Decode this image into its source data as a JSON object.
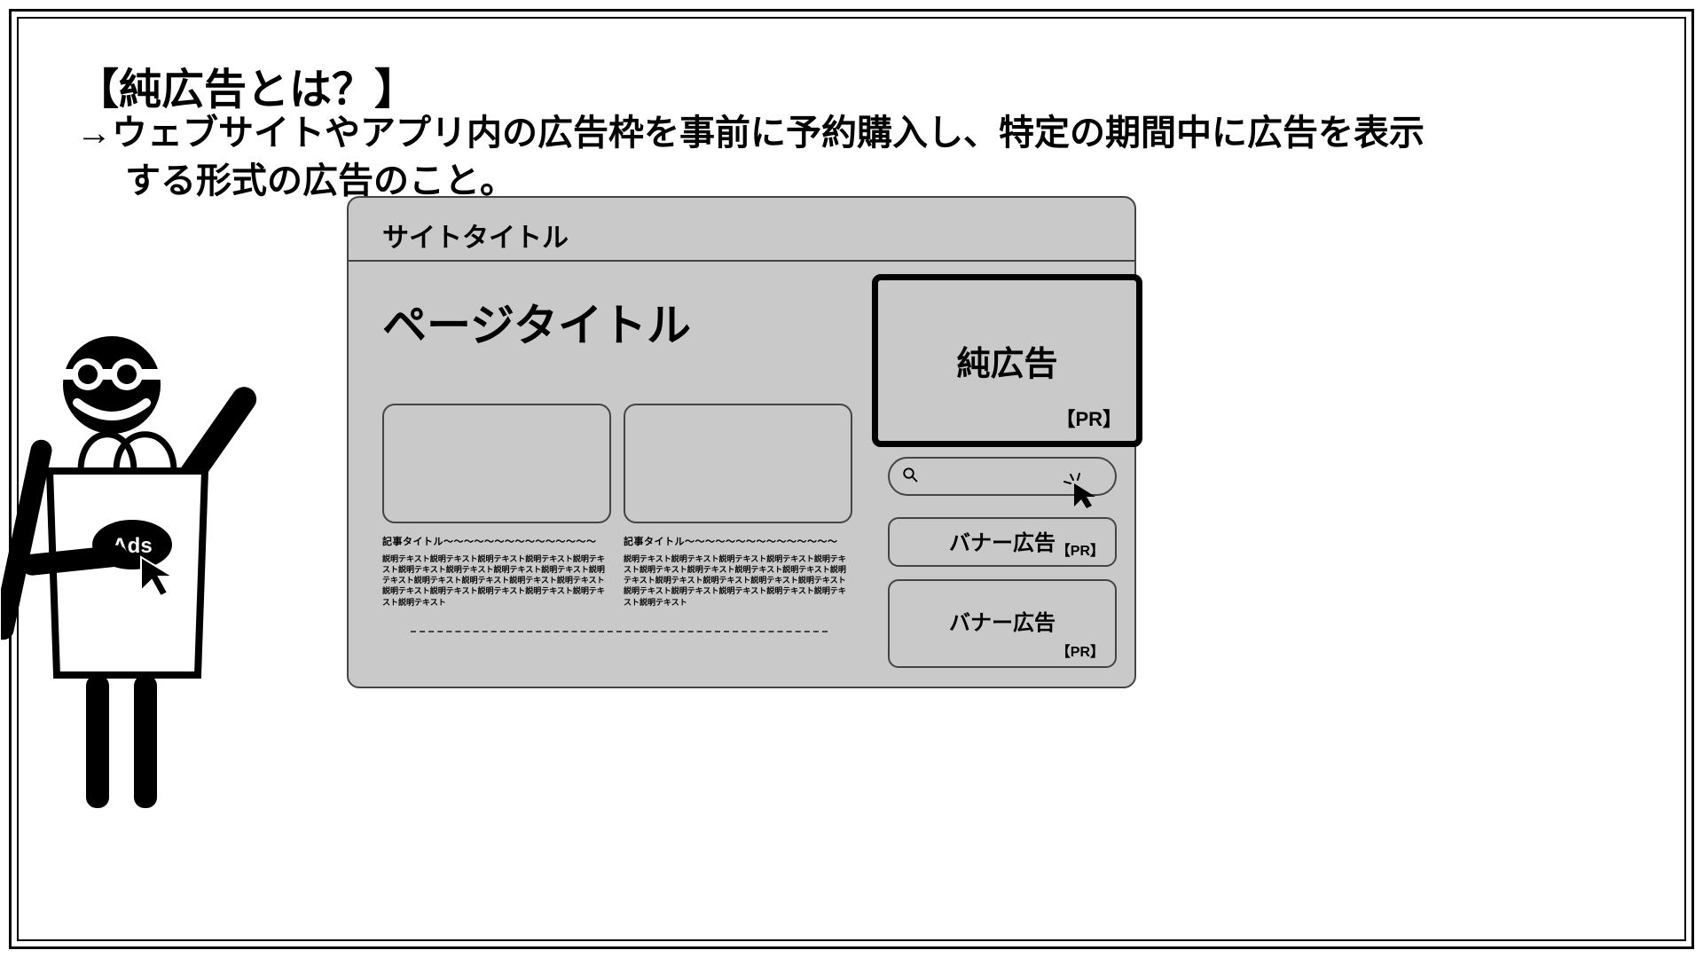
{
  "heading": "【純広告とは？】",
  "description": {
    "line1": "→ウェブサイトやアプリ内の広告枠を事前に予約購入し、特定の期間中に広告を表示",
    "line2": "する形式の広告のこと。"
  },
  "mascot": {
    "badge_text": "Ads"
  },
  "site": {
    "header_title": "サイトタイトル",
    "page_title": "ページタイトル",
    "articles": [
      {
        "title": "記事タイトル～～～～～～～～～～～～～～～",
        "body": "説明テキスト説明テキスト説明テキスト説明テキスト説明テキスト説明テキスト説明テキスト説明テキスト説明テキスト説明テキスト説明テキスト説明テキスト説明テキスト説明テキスト説明テキスト説明テキスト説明テキスト説明テキスト説明テキスト説明テキスト"
      },
      {
        "title": "記事タイトル～～～～～～～～～～～～～～～",
        "body": "説明テキスト説明テキスト説明テキスト説明テキスト説明テキスト説明テキスト説明テキスト説明テキスト説明テキスト説明テキスト説明テキスト説明テキスト説明テキスト説明テキスト説明テキスト説明テキスト説明テキスト説明テキスト説明テキスト説明テキスト"
      }
    ]
  },
  "sidebar": {
    "hero_ad": {
      "label": "純広告",
      "pr": "【PR】"
    },
    "search_placeholder": "",
    "banners": [
      {
        "label": "バナー広告",
        "pr": "【PR】"
      },
      {
        "label": "バナー広告",
        "pr": "【PR】"
      }
    ]
  }
}
